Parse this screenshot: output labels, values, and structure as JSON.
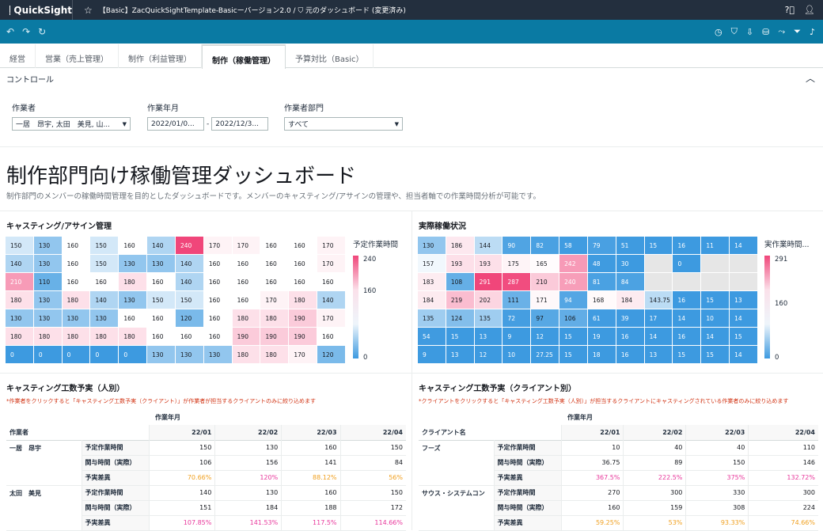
{
  "app": {
    "name": "QuickSight",
    "title": "【Basic】ZacQuickSightTemplate-Basicーバージョン2.0 / ⛉ 元のダッシュボード (変更済み)"
  },
  "tabs": [
    "経営",
    "営業（売上管理）",
    "制作（利益管理）",
    "制作（稼働管理）",
    "予算対比（Basic）"
  ],
  "controls": {
    "header": "コントロール",
    "worker": {
      "label": "作業者",
      "value": "一居　昂宇, 太田　美見, 山..."
    },
    "month": {
      "label": "作業年月",
      "from": "2022/01/0...",
      "to": "2022/12/3...",
      "dash": "-"
    },
    "dept": {
      "label": "作業者部門",
      "value": "すべて"
    }
  },
  "sheet": {
    "title": "制作部門向け稼働管理ダッシュボード",
    "desc": "制作部門のメンバーの稼働時間管理を目的としたダッシュボードです。メンバーのキャスティング/アサインの管理や、担当者軸での作業時間分析が可能です。"
  },
  "hm1": {
    "title": "キャスティング/アサイン管理",
    "legend": {
      "title": "予定作業時間",
      "max": "240",
      "mid": "160",
      "min": "0"
    },
    "rows": [
      [
        "150",
        "130",
        "160",
        "150",
        "160",
        "140",
        "240",
        "170",
        "170",
        "160",
        "160",
        "170"
      ],
      [
        "140",
        "130",
        "160",
        "150",
        "130",
        "130",
        "140",
        "160",
        "160",
        "160",
        "160",
        "170"
      ],
      [
        "210",
        "110",
        "160",
        "160",
        "180",
        "160",
        "140",
        "160",
        "160",
        "160",
        "160",
        "160"
      ],
      [
        "180",
        "130",
        "180",
        "140",
        "130",
        "150",
        "150",
        "160",
        "160",
        "170",
        "180",
        "140"
      ],
      [
        "130",
        "130",
        "130",
        "130",
        "160",
        "160",
        "120",
        "160",
        "180",
        "180",
        "190",
        "170"
      ],
      [
        "180",
        "180",
        "180",
        "180",
        "180",
        "160",
        "160",
        "160",
        "190",
        "190",
        "190",
        "160"
      ],
      [
        "0",
        "0",
        "0",
        "0",
        "0",
        "130",
        "130",
        "130",
        "180",
        "180",
        "170",
        "120"
      ]
    ]
  },
  "hm2": {
    "title": "実際稼働状況",
    "legend": {
      "title": "実作業時間...",
      "max": "291",
      "mid": "160",
      "min": "0"
    },
    "rows": [
      [
        "130",
        "186",
        "144",
        "90",
        "82",
        "58",
        "79",
        "51",
        "15",
        "16",
        "11",
        "14"
      ],
      [
        "157",
        "193",
        "193",
        "175",
        "165",
        "242",
        "48",
        "30",
        "",
        "0",
        "",
        ""
      ],
      [
        "183",
        "108",
        "291",
        "287",
        "210",
        "240",
        "81",
        "84",
        "",
        "",
        "",
        ""
      ],
      [
        "184",
        "219",
        "202",
        "111",
        "171",
        "94",
        "168",
        "184",
        "143.75",
        "16",
        "15",
        "13"
      ],
      [
        "135",
        "124",
        "135",
        "72",
        "97",
        "106",
        "61",
        "39",
        "17",
        "14",
        "10",
        "14"
      ],
      [
        "54",
        "15",
        "13",
        "9",
        "12",
        "15",
        "19",
        "16",
        "14",
        "16",
        "14",
        "15"
      ],
      [
        "9",
        "13",
        "12",
        "10",
        "27.25",
        "15",
        "18",
        "16",
        "13",
        "15",
        "15",
        "14"
      ]
    ]
  },
  "pt1": {
    "title": "キャスティング工数予実（人別）",
    "note": "*作業者をクリックすると「キャスティング工数予実（クライアント）」が作業者が担当するクライアントのみに絞り込めます",
    "colgroup": "作業年月",
    "rowhead": "作業者",
    "cols": [
      "22/01",
      "22/02",
      "22/03",
      "22/04"
    ],
    "groups": [
      {
        "name": "一居　昂宇",
        "rows": [
          {
            "label": "予定作業時間",
            "vals": [
              "150",
              "130",
              "160",
              "150"
            ]
          },
          {
            "label": "関与時間（実際）",
            "vals": [
              "106",
              "156",
              "141",
              "84"
            ]
          },
          {
            "label": "予実差異",
            "vals": [
              "70.66%",
              "120%",
              "88.12%",
              "56%"
            ]
          }
        ]
      },
      {
        "name": "太田　美見",
        "rows": [
          {
            "label": "予定作業時間",
            "vals": [
              "140",
              "130",
              "160",
              "150"
            ]
          },
          {
            "label": "関与時間（実際）",
            "vals": [
              "151",
              "184",
              "188",
              "172"
            ]
          },
          {
            "label": "予実差異",
            "vals": [
              "107.85%",
              "141.53%",
              "117.5%",
              "114.66%"
            ]
          }
        ]
      }
    ]
  },
  "pt2": {
    "title": "キャスティング工数予実（クライアント別）",
    "note": "*クライアントをクリックすると「キャスティング工数予実（人別）」が担当するクライアントにキャスティングされている作業者のみに絞り込めます",
    "colgroup": "作業年月",
    "rowhead": "クライアント名",
    "cols": [
      "22/01",
      "22/02",
      "22/03",
      "22/04"
    ],
    "groups": [
      {
        "name": "フーズ",
        "rows": [
          {
            "label": "予定作業時間",
            "vals": [
              "10",
              "40",
              "40",
              "110"
            ]
          },
          {
            "label": "関与時間（実際）",
            "vals": [
              "36.75",
              "89",
              "150",
              "146"
            ]
          },
          {
            "label": "予実差異",
            "vals": [
              "367.5%",
              "222.5%",
              "375%",
              "132.72%"
            ]
          }
        ]
      },
      {
        "name": "サウス・システムコン",
        "rows": [
          {
            "label": "予定作業時間",
            "vals": [
              "270",
              "300",
              "330",
              "300"
            ]
          },
          {
            "label": "関与時間（実際）",
            "vals": [
              "160",
              "159",
              "308",
              "224"
            ]
          },
          {
            "label": "予実差異",
            "vals": [
              "59.25%",
              "53%",
              "93.33%",
              "74.66%"
            ]
          }
        ]
      }
    ]
  },
  "colors": {
    "high": "#f0467a",
    "mid": "#ffffff",
    "low": "#3d9ae0",
    "empty": "#e6e6e6",
    "orange": "#f0a020",
    "pink": "#e8379b"
  }
}
